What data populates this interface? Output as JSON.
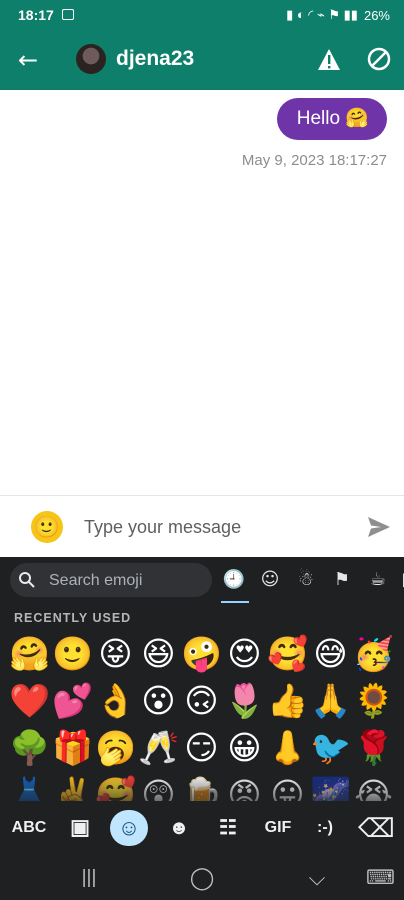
{
  "status_bar": {
    "time": "18:17",
    "battery": "26%",
    "signal": "▮ ◐ ◜ ⌁ ⚑ ▮▮"
  },
  "app_bar": {
    "contact_name": "djena23"
  },
  "chat": {
    "message": "Hello 🤗",
    "timestamp": "May 9, 2023 18:17:27"
  },
  "composer": {
    "emoji_button": "🙂",
    "placeholder": "Type your message"
  },
  "keyboard": {
    "search_placeholder": "Search emoji",
    "recently_used_label": "RECENTLY USED",
    "emojis": [
      "🤗",
      "🙂",
      "😝",
      "😆",
      "🤪",
      "😍",
      "🥰",
      "😅",
      "🥳",
      "❤️",
      "💕",
      "👌",
      "😮",
      "🙃",
      "🌷",
      "👍",
      "🙏",
      "🌻",
      "🌳",
      "🎁",
      "🥱",
      "🥂",
      "😏",
      "😀",
      "👃",
      "🐦",
      "🌹",
      "👗",
      "✌️",
      "🥰",
      "😲",
      "🍺",
      "😡",
      "😛",
      "🌌",
      "😭"
    ],
    "categories": [
      "🕘",
      "☺",
      "☃",
      "⚑",
      "☕",
      "▣"
    ],
    "toolbar": {
      "abc": "ABC",
      "sticker": "▣",
      "emoji": "☺",
      "emoticon": "☻",
      "sticker2": "☷",
      "gif": "GIF",
      "text_face": ":-)",
      "delete": "⌫"
    },
    "navigation": {
      "recents": "|||",
      "home": "◯",
      "back": "⌵",
      "keyboard": "⌨"
    }
  },
  "colors": {
    "app_bar": "#0e7f6a",
    "bubble": "#6f35a8",
    "keyboard": "#1f2022",
    "active_emoji": "#bfe5ff"
  }
}
